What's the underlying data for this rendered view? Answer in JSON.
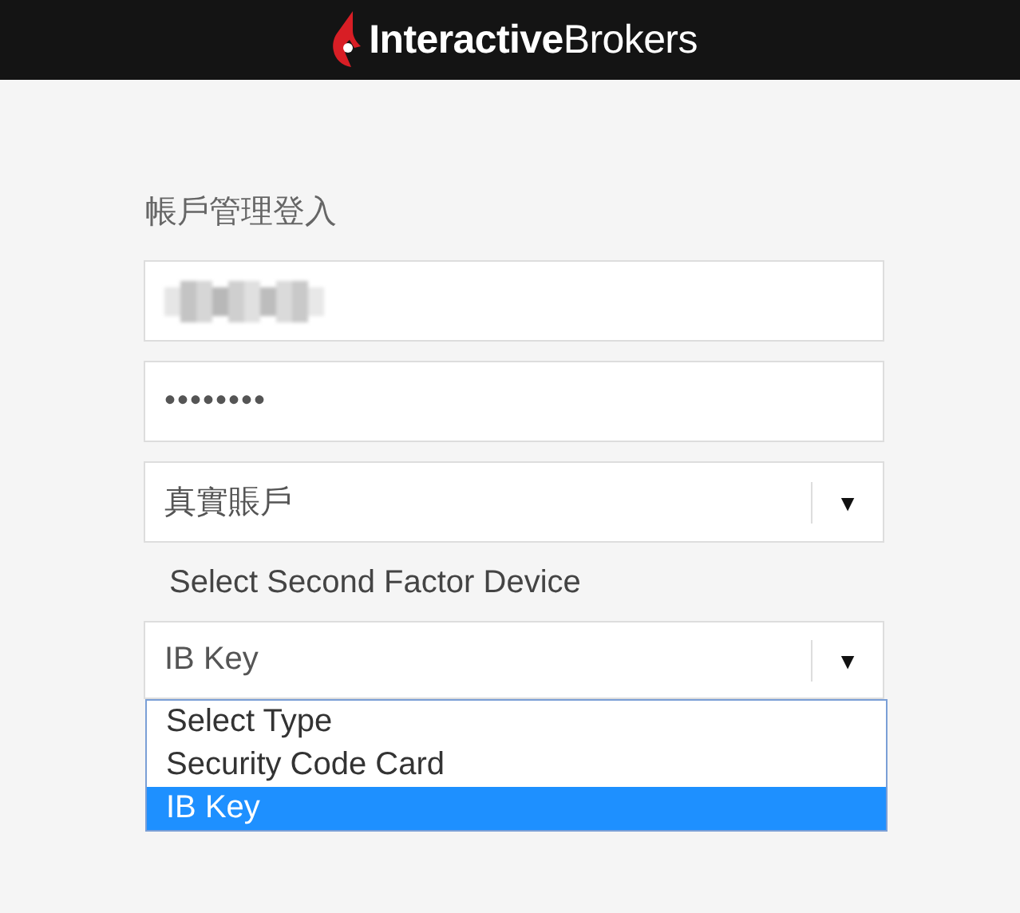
{
  "header": {
    "logo_text": "**Interactive**Brokers"
  },
  "login": {
    "title": "帳戶管理登入",
    "fields": [
      {
        "kind": "redacted"
      },
      {
        "kind": "password",
        "value": "••••••••"
      },
      {
        "kind": "select",
        "value": "真實賬戶",
        "arrow": "▼"
      }
    ],
    "second_factor": {
      "label": "Select Second Factor Device",
      "value": "IB Key",
      "arrow": "▼",
      "expanded": true,
      "options": [
        {
          "label": "Select Type",
          "selected": false
        },
        {
          "label": "Security Code Card",
          "selected": false
        },
        {
          "label": "IB Key",
          "selected": true
        }
      ]
    }
  }
}
